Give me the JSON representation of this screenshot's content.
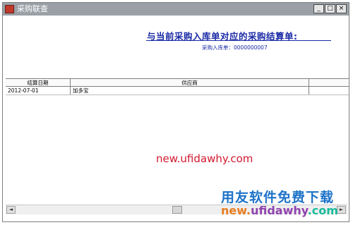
{
  "window": {
    "title": "采购联查",
    "icon": "app-icon",
    "controls": {
      "minimize": "_",
      "maximize": "□",
      "close": "×"
    }
  },
  "report": {
    "heading": "与当前采购入库单对应的采购结算单:",
    "subheading": "采购入库单：0000000007"
  },
  "table": {
    "columns": [
      "结算日期",
      "供应商",
      ""
    ],
    "rows": [
      {
        "settle_date": "2012-07-01",
        "supplier": "加多宝",
        "extra": ""
      }
    ]
  },
  "watermarks": {
    "center": "new.ufidawhy.com",
    "brand_line1": "用友软件免费下载",
    "brand_line2_parts": [
      "new.",
      "ufidawhy",
      ".com"
    ]
  },
  "scrollbar": {
    "left_arrow": "◄",
    "right_arrow": "►"
  },
  "colors": {
    "heading": "#1a2aa6",
    "watermark_red": "#d0192f",
    "brand_blue": "#1e73c8"
  }
}
